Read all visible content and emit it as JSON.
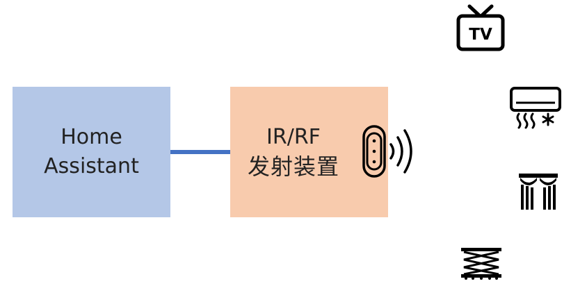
{
  "nodes": {
    "home_assistant": {
      "line1": "Home",
      "line2": "Assistant"
    },
    "ir_rf_device": {
      "line1": "IR/RF",
      "line2": "发射装置"
    }
  },
  "icons": {
    "transmitter": "ir-transmitter-icon",
    "tv": "tv-icon",
    "tv_text": "TV",
    "air_conditioner": "air-conditioner-icon",
    "curtain": "curtain-icon",
    "lift": "scissor-lift-icon"
  },
  "colors": {
    "home_assistant_fill": "#b4c7e7",
    "ir_rf_fill": "#f8cbad",
    "connector": "#4472c4",
    "icon": "#000000"
  }
}
